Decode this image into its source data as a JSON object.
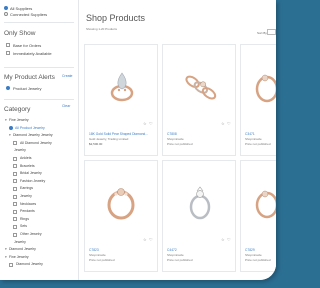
{
  "sidebar": {
    "top_options": [
      {
        "label": "All Suppliers",
        "selected": true
      },
      {
        "label": "Connected Suppliers",
        "selected": false
      }
    ],
    "only_show": {
      "heading": "Only Show",
      "items": [
        "Base for Orders",
        "Immediately Available"
      ]
    },
    "product_alerts": {
      "heading": "My Product Alerts",
      "link": "Create",
      "selected": "Product Jewelry"
    },
    "category": {
      "heading": "Category",
      "link": "Clear",
      "items": [
        {
          "label": "Fine Jewelry",
          "level": 0,
          "type": "tree"
        },
        {
          "label": "All Product Jewelry",
          "level": 1,
          "type": "radio"
        },
        {
          "label": "Diamond Jewelry Jewelry",
          "level": 1,
          "type": "tree"
        },
        {
          "label": "All Diamond Jewelry",
          "level": 2,
          "type": "check"
        },
        {
          "label": "Jewelry",
          "level": 1,
          "type": "text"
        },
        {
          "label": "Anklets",
          "level": 2,
          "type": "check"
        },
        {
          "label": "Bracelets",
          "level": 2,
          "type": "check"
        },
        {
          "label": "Bridal Jewelry",
          "level": 2,
          "type": "check"
        },
        {
          "label": "Fashion Jewelry",
          "level": 2,
          "type": "check"
        },
        {
          "label": "Earrings",
          "level": 2,
          "type": "check"
        },
        {
          "label": "Jewelry",
          "level": 2,
          "type": "check"
        },
        {
          "label": "Necklaces",
          "level": 2,
          "type": "check"
        },
        {
          "label": "Pendants",
          "level": 2,
          "type": "check"
        },
        {
          "label": "Rings",
          "level": 2,
          "type": "check"
        },
        {
          "label": "Sets",
          "level": 2,
          "type": "check"
        },
        {
          "label": "Other Jewelry",
          "level": 2,
          "type": "check"
        },
        {
          "label": "Jewelry",
          "level": 1,
          "type": "text"
        },
        {
          "label": "Diamond Jewelry",
          "level": 0,
          "type": "tree"
        },
        {
          "label": "Fine Jewelry",
          "level": 0,
          "type": "tree"
        },
        {
          "label": "Diamond Jewelry",
          "level": 1,
          "type": "check"
        }
      ]
    }
  },
  "main": {
    "title": "Shop Products",
    "count_text": "Showing 1-20 Products",
    "sort_label": "Sort By",
    "filter_label": "Filter"
  },
  "products": [
    {
      "name": "18K Gold Solid Pear Shaped Diamond...",
      "line2": "Gold Jewelry, Trading Limited",
      "line3": "$2,500.00",
      "art": "solitaire",
      "priced": true
    },
    {
      "name": "C7808",
      "line2": "Shopmiracle",
      "line3": "Price not published",
      "art": "trio",
      "priced": false
    },
    {
      "name": "C3471",
      "line2": "Shopmiracle",
      "line3": "Price not published",
      "art": "partial",
      "priced": false
    },
    {
      "name": "C7823",
      "line2": "Shopmiracle",
      "line3": "Price not published",
      "art": "band",
      "priced": false
    },
    {
      "name": "C4472",
      "line2": "Shopmiracle",
      "line3": "Price not published",
      "art": "silver",
      "priced": false
    },
    {
      "name": "C7829",
      "line2": "Shopmiracle",
      "line3": "Price not published",
      "art": "partial",
      "priced": false
    }
  ],
  "colors": {
    "accent": "#3b7cc4",
    "rose_gold": "#d7a383",
    "gem": "#cfd6dc",
    "frame": "#2b6f93"
  },
  "icons": [
    "favorite-icon",
    "heart-icon"
  ]
}
